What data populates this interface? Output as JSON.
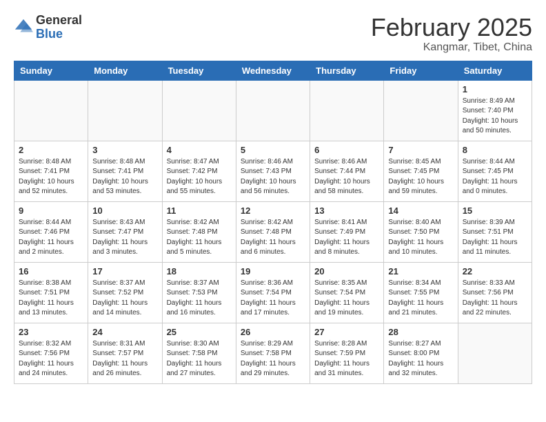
{
  "header": {
    "logo_general": "General",
    "logo_blue": "Blue",
    "month": "February 2025",
    "location": "Kangmar, Tibet, China"
  },
  "weekdays": [
    "Sunday",
    "Monday",
    "Tuesday",
    "Wednesday",
    "Thursday",
    "Friday",
    "Saturday"
  ],
  "weeks": [
    [
      {
        "day": "",
        "info": ""
      },
      {
        "day": "",
        "info": ""
      },
      {
        "day": "",
        "info": ""
      },
      {
        "day": "",
        "info": ""
      },
      {
        "day": "",
        "info": ""
      },
      {
        "day": "",
        "info": ""
      },
      {
        "day": "1",
        "info": "Sunrise: 8:49 AM\nSunset: 7:40 PM\nDaylight: 10 hours\nand 50 minutes."
      }
    ],
    [
      {
        "day": "2",
        "info": "Sunrise: 8:48 AM\nSunset: 7:41 PM\nDaylight: 10 hours\nand 52 minutes."
      },
      {
        "day": "3",
        "info": "Sunrise: 8:48 AM\nSunset: 7:41 PM\nDaylight: 10 hours\nand 53 minutes."
      },
      {
        "day": "4",
        "info": "Sunrise: 8:47 AM\nSunset: 7:42 PM\nDaylight: 10 hours\nand 55 minutes."
      },
      {
        "day": "5",
        "info": "Sunrise: 8:46 AM\nSunset: 7:43 PM\nDaylight: 10 hours\nand 56 minutes."
      },
      {
        "day": "6",
        "info": "Sunrise: 8:46 AM\nSunset: 7:44 PM\nDaylight: 10 hours\nand 58 minutes."
      },
      {
        "day": "7",
        "info": "Sunrise: 8:45 AM\nSunset: 7:45 PM\nDaylight: 10 hours\nand 59 minutes."
      },
      {
        "day": "8",
        "info": "Sunrise: 8:44 AM\nSunset: 7:45 PM\nDaylight: 11 hours\nand 0 minutes."
      }
    ],
    [
      {
        "day": "9",
        "info": "Sunrise: 8:44 AM\nSunset: 7:46 PM\nDaylight: 11 hours\nand 2 minutes."
      },
      {
        "day": "10",
        "info": "Sunrise: 8:43 AM\nSunset: 7:47 PM\nDaylight: 11 hours\nand 3 minutes."
      },
      {
        "day": "11",
        "info": "Sunrise: 8:42 AM\nSunset: 7:48 PM\nDaylight: 11 hours\nand 5 minutes."
      },
      {
        "day": "12",
        "info": "Sunrise: 8:42 AM\nSunset: 7:48 PM\nDaylight: 11 hours\nand 6 minutes."
      },
      {
        "day": "13",
        "info": "Sunrise: 8:41 AM\nSunset: 7:49 PM\nDaylight: 11 hours\nand 8 minutes."
      },
      {
        "day": "14",
        "info": "Sunrise: 8:40 AM\nSunset: 7:50 PM\nDaylight: 11 hours\nand 10 minutes."
      },
      {
        "day": "15",
        "info": "Sunrise: 8:39 AM\nSunset: 7:51 PM\nDaylight: 11 hours\nand 11 minutes."
      }
    ],
    [
      {
        "day": "16",
        "info": "Sunrise: 8:38 AM\nSunset: 7:51 PM\nDaylight: 11 hours\nand 13 minutes."
      },
      {
        "day": "17",
        "info": "Sunrise: 8:37 AM\nSunset: 7:52 PM\nDaylight: 11 hours\nand 14 minutes."
      },
      {
        "day": "18",
        "info": "Sunrise: 8:37 AM\nSunset: 7:53 PM\nDaylight: 11 hours\nand 16 minutes."
      },
      {
        "day": "19",
        "info": "Sunrise: 8:36 AM\nSunset: 7:54 PM\nDaylight: 11 hours\nand 17 minutes."
      },
      {
        "day": "20",
        "info": "Sunrise: 8:35 AM\nSunset: 7:54 PM\nDaylight: 11 hours\nand 19 minutes."
      },
      {
        "day": "21",
        "info": "Sunrise: 8:34 AM\nSunset: 7:55 PM\nDaylight: 11 hours\nand 21 minutes."
      },
      {
        "day": "22",
        "info": "Sunrise: 8:33 AM\nSunset: 7:56 PM\nDaylight: 11 hours\nand 22 minutes."
      }
    ],
    [
      {
        "day": "23",
        "info": "Sunrise: 8:32 AM\nSunset: 7:56 PM\nDaylight: 11 hours\nand 24 minutes."
      },
      {
        "day": "24",
        "info": "Sunrise: 8:31 AM\nSunset: 7:57 PM\nDaylight: 11 hours\nand 26 minutes."
      },
      {
        "day": "25",
        "info": "Sunrise: 8:30 AM\nSunset: 7:58 PM\nDaylight: 11 hours\nand 27 minutes."
      },
      {
        "day": "26",
        "info": "Sunrise: 8:29 AM\nSunset: 7:58 PM\nDaylight: 11 hours\nand 29 minutes."
      },
      {
        "day": "27",
        "info": "Sunrise: 8:28 AM\nSunset: 7:59 PM\nDaylight: 11 hours\nand 31 minutes."
      },
      {
        "day": "28",
        "info": "Sunrise: 8:27 AM\nSunset: 8:00 PM\nDaylight: 11 hours\nand 32 minutes."
      },
      {
        "day": "",
        "info": ""
      }
    ]
  ]
}
